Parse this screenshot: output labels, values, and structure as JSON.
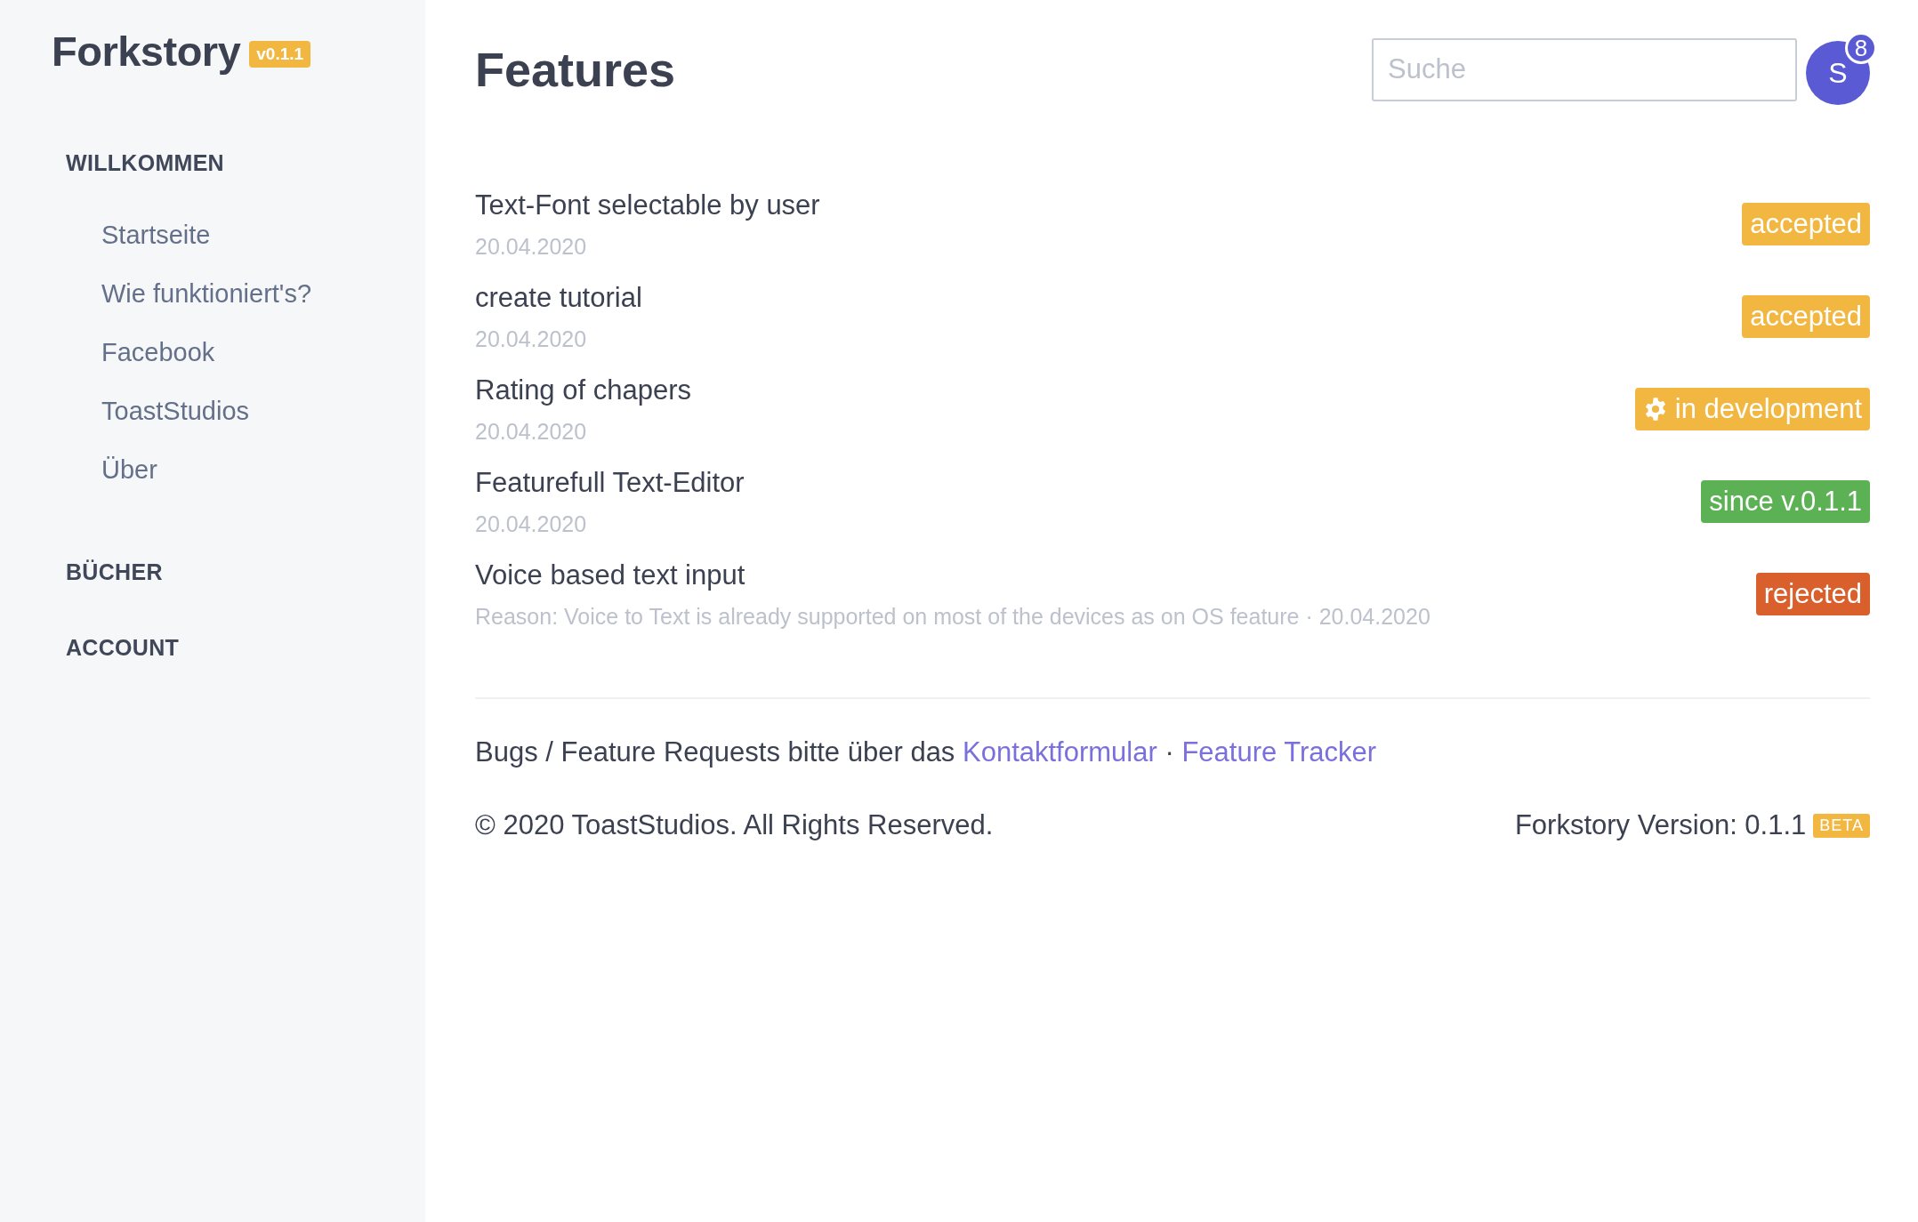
{
  "sidebar": {
    "logo": "Forkstory",
    "version_badge": "v0.1.1",
    "sections": [
      {
        "title": "WILLKOMMEN",
        "items": [
          {
            "label": "Startseite"
          },
          {
            "label": "Wie funktioniert's?"
          },
          {
            "label": "Facebook"
          },
          {
            "label": "ToastStudios"
          },
          {
            "label": "Über"
          }
        ]
      },
      {
        "title": "BÜCHER"
      },
      {
        "title": "ACCOUNT"
      }
    ]
  },
  "header": {
    "title": "Features",
    "search": {
      "placeholder": "Suche"
    },
    "avatar": {
      "initial": "S",
      "notification_count": "8"
    }
  },
  "features": [
    {
      "title": "Text-Font selectable by user",
      "meta": "20.04.2020",
      "status": {
        "label": "accepted",
        "kind": "plain",
        "color": "#f2b740"
      }
    },
    {
      "title": "create tutorial",
      "meta": "20.04.2020",
      "status": {
        "label": "accepted",
        "kind": "plain",
        "color": "#f2b740"
      }
    },
    {
      "title": "Rating of chapers",
      "meta": "20.04.2020",
      "status": {
        "label": "in development",
        "kind": "gear",
        "color": "#f2b740"
      }
    },
    {
      "title": "Featurefull Text-Editor",
      "meta": "20.04.2020",
      "status": {
        "label": "since v.0.1.1",
        "kind": "plain",
        "color": "#5cb155"
      }
    },
    {
      "title": "Voice based text input",
      "meta": "Reason: Voice to Text is already supported on most of the devices as on OS feature · 20.04.2020",
      "status": {
        "label": "rejected",
        "kind": "plain",
        "color": "#d9602c"
      }
    }
  ],
  "footer": {
    "text": "Bugs / Feature Requests bitte über das",
    "links": [
      {
        "label": "Kontaktformular"
      },
      {
        "label": "Feature Tracker"
      }
    ],
    "link_separator": "·",
    "copyright": "© 2020 ToastStudios. All Rights Reserved.",
    "version": "Forkstory Version: 0.1.1",
    "version_badge": "BETA"
  }
}
